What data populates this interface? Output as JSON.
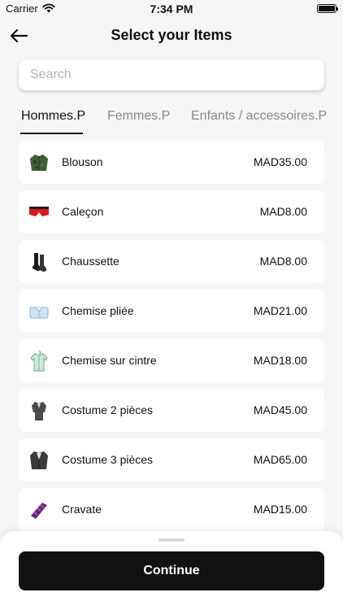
{
  "status_bar": {
    "carrier": "Carrier",
    "time": "7:34 PM"
  },
  "header": {
    "title": "Select your Items",
    "back_icon": "arrow-left-icon"
  },
  "search": {
    "placeholder": "Search",
    "value": ""
  },
  "tabs": [
    {
      "label": "Hommes.P",
      "active": true
    },
    {
      "label": "Femmes.P",
      "active": false
    },
    {
      "label": "Enfants / accessoires.P",
      "active": false
    }
  ],
  "items": [
    {
      "name": "Blouson",
      "price": "MAD35.00",
      "icon": "jacket-icon"
    },
    {
      "name": "Caleçon",
      "price": "MAD8.00",
      "icon": "boxer-shorts-icon"
    },
    {
      "name": "Chaussette",
      "price": "MAD8.00",
      "icon": "socks-icon"
    },
    {
      "name": "Chemise pliée",
      "price": "MAD21.00",
      "icon": "folded-shirt-icon"
    },
    {
      "name": "Chemise sur cintre",
      "price": "MAD18.00",
      "icon": "hanging-shirt-icon"
    },
    {
      "name": "Costume 2 pièces",
      "price": "MAD45.00",
      "icon": "suit-2-piece-icon"
    },
    {
      "name": "Costume 3 pièces",
      "price": "MAD65.00",
      "icon": "suit-3-piece-icon"
    },
    {
      "name": "Cravate",
      "price": "MAD15.00",
      "icon": "tie-icon"
    }
  ],
  "footer": {
    "continue_label": "Continue"
  }
}
